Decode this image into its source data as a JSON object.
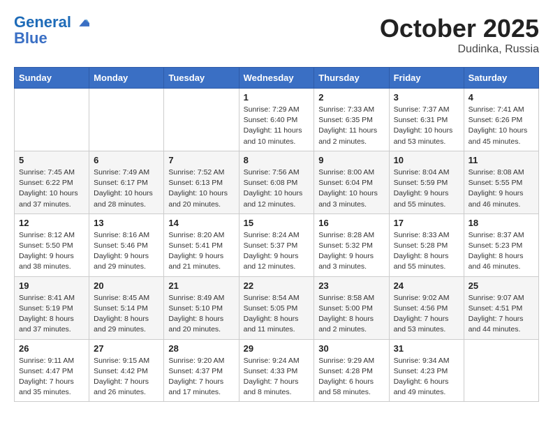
{
  "header": {
    "logo_line1": "General",
    "logo_line2": "Blue",
    "month": "October 2025",
    "location": "Dudinka, Russia"
  },
  "weekdays": [
    "Sunday",
    "Monday",
    "Tuesday",
    "Wednesday",
    "Thursday",
    "Friday",
    "Saturday"
  ],
  "weeks": [
    [
      {
        "day": "",
        "info": ""
      },
      {
        "day": "",
        "info": ""
      },
      {
        "day": "",
        "info": ""
      },
      {
        "day": "1",
        "info": "Sunrise: 7:29 AM\nSunset: 6:40 PM\nDaylight: 11 hours\nand 10 minutes."
      },
      {
        "day": "2",
        "info": "Sunrise: 7:33 AM\nSunset: 6:35 PM\nDaylight: 11 hours\nand 2 minutes."
      },
      {
        "day": "3",
        "info": "Sunrise: 7:37 AM\nSunset: 6:31 PM\nDaylight: 10 hours\nand 53 minutes."
      },
      {
        "day": "4",
        "info": "Sunrise: 7:41 AM\nSunset: 6:26 PM\nDaylight: 10 hours\nand 45 minutes."
      }
    ],
    [
      {
        "day": "5",
        "info": "Sunrise: 7:45 AM\nSunset: 6:22 PM\nDaylight: 10 hours\nand 37 minutes."
      },
      {
        "day": "6",
        "info": "Sunrise: 7:49 AM\nSunset: 6:17 PM\nDaylight: 10 hours\nand 28 minutes."
      },
      {
        "day": "7",
        "info": "Sunrise: 7:52 AM\nSunset: 6:13 PM\nDaylight: 10 hours\nand 20 minutes."
      },
      {
        "day": "8",
        "info": "Sunrise: 7:56 AM\nSunset: 6:08 PM\nDaylight: 10 hours\nand 12 minutes."
      },
      {
        "day": "9",
        "info": "Sunrise: 8:00 AM\nSunset: 6:04 PM\nDaylight: 10 hours\nand 3 minutes."
      },
      {
        "day": "10",
        "info": "Sunrise: 8:04 AM\nSunset: 5:59 PM\nDaylight: 9 hours\nand 55 minutes."
      },
      {
        "day": "11",
        "info": "Sunrise: 8:08 AM\nSunset: 5:55 PM\nDaylight: 9 hours\nand 46 minutes."
      }
    ],
    [
      {
        "day": "12",
        "info": "Sunrise: 8:12 AM\nSunset: 5:50 PM\nDaylight: 9 hours\nand 38 minutes."
      },
      {
        "day": "13",
        "info": "Sunrise: 8:16 AM\nSunset: 5:46 PM\nDaylight: 9 hours\nand 29 minutes."
      },
      {
        "day": "14",
        "info": "Sunrise: 8:20 AM\nSunset: 5:41 PM\nDaylight: 9 hours\nand 21 minutes."
      },
      {
        "day": "15",
        "info": "Sunrise: 8:24 AM\nSunset: 5:37 PM\nDaylight: 9 hours\nand 12 minutes."
      },
      {
        "day": "16",
        "info": "Sunrise: 8:28 AM\nSunset: 5:32 PM\nDaylight: 9 hours\nand 3 minutes."
      },
      {
        "day": "17",
        "info": "Sunrise: 8:33 AM\nSunset: 5:28 PM\nDaylight: 8 hours\nand 55 minutes."
      },
      {
        "day": "18",
        "info": "Sunrise: 8:37 AM\nSunset: 5:23 PM\nDaylight: 8 hours\nand 46 minutes."
      }
    ],
    [
      {
        "day": "19",
        "info": "Sunrise: 8:41 AM\nSunset: 5:19 PM\nDaylight: 8 hours\nand 37 minutes."
      },
      {
        "day": "20",
        "info": "Sunrise: 8:45 AM\nSunset: 5:14 PM\nDaylight: 8 hours\nand 29 minutes."
      },
      {
        "day": "21",
        "info": "Sunrise: 8:49 AM\nSunset: 5:10 PM\nDaylight: 8 hours\nand 20 minutes."
      },
      {
        "day": "22",
        "info": "Sunrise: 8:54 AM\nSunset: 5:05 PM\nDaylight: 8 hours\nand 11 minutes."
      },
      {
        "day": "23",
        "info": "Sunrise: 8:58 AM\nSunset: 5:00 PM\nDaylight: 8 hours\nand 2 minutes."
      },
      {
        "day": "24",
        "info": "Sunrise: 9:02 AM\nSunset: 4:56 PM\nDaylight: 7 hours\nand 53 minutes."
      },
      {
        "day": "25",
        "info": "Sunrise: 9:07 AM\nSunset: 4:51 PM\nDaylight: 7 hours\nand 44 minutes."
      }
    ],
    [
      {
        "day": "26",
        "info": "Sunrise: 9:11 AM\nSunset: 4:47 PM\nDaylight: 7 hours\nand 35 minutes."
      },
      {
        "day": "27",
        "info": "Sunrise: 9:15 AM\nSunset: 4:42 PM\nDaylight: 7 hours\nand 26 minutes."
      },
      {
        "day": "28",
        "info": "Sunrise: 9:20 AM\nSunset: 4:37 PM\nDaylight: 7 hours\nand 17 minutes."
      },
      {
        "day": "29",
        "info": "Sunrise: 9:24 AM\nSunset: 4:33 PM\nDaylight: 7 hours\nand 8 minutes."
      },
      {
        "day": "30",
        "info": "Sunrise: 9:29 AM\nSunset: 4:28 PM\nDaylight: 6 hours\nand 58 minutes."
      },
      {
        "day": "31",
        "info": "Sunrise: 9:34 AM\nSunset: 4:23 PM\nDaylight: 6 hours\nand 49 minutes."
      },
      {
        "day": "",
        "info": ""
      }
    ]
  ]
}
